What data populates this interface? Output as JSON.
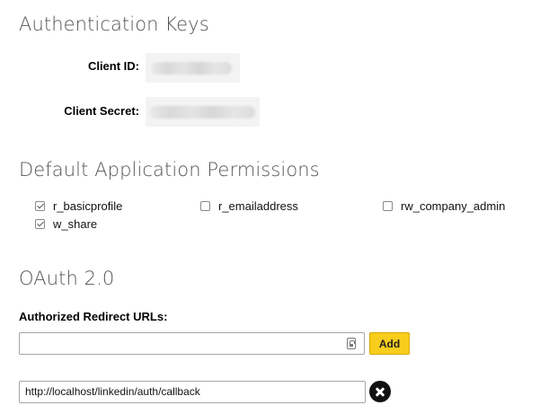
{
  "auth_keys": {
    "heading": "Authentication Keys",
    "client_id_label": "Client ID:",
    "client_secret_label": "Client Secret:"
  },
  "permissions": {
    "heading": "Default Application Permissions",
    "items": [
      {
        "label": "r_basicprofile",
        "checked": true
      },
      {
        "label": "r_emailaddress",
        "checked": false
      },
      {
        "label": "rw_company_admin",
        "checked": false
      },
      {
        "label": "w_share",
        "checked": true
      }
    ]
  },
  "oauth": {
    "heading": "OAuth 2.0",
    "redirect_label": "Authorized Redirect URLs:",
    "new_url_value": "",
    "add_label": "Add",
    "urls": [
      "http://localhost/linkedin/auth/callback"
    ]
  },
  "icons": {
    "input_icon": "clipboard-icon",
    "remove_icon": "close-circle-icon"
  },
  "colors": {
    "add_button": "#f8cd1b",
    "heading_text": "#555555"
  }
}
